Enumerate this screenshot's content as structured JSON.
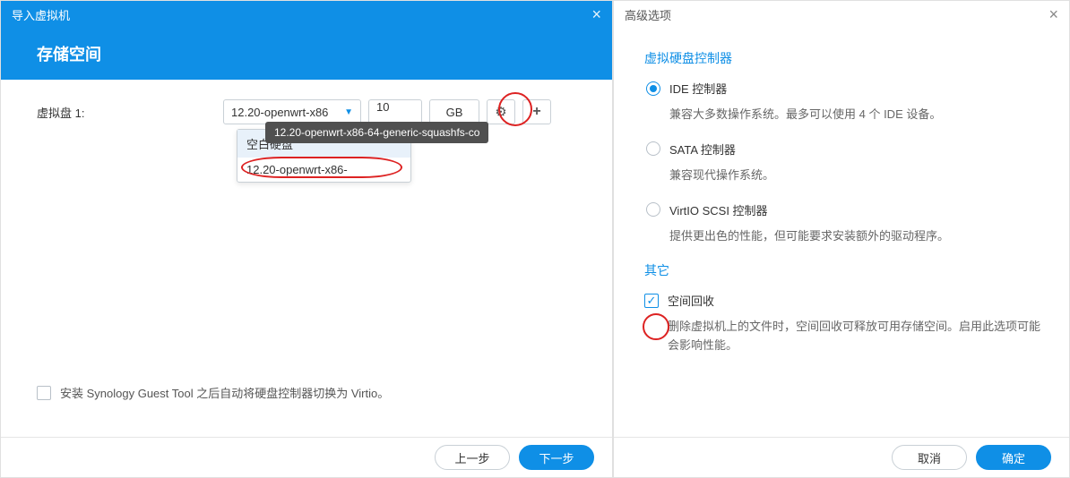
{
  "left": {
    "title": "导入虚拟机",
    "subtitle": "存储空间",
    "disk_label": "虚拟盘 1:",
    "disk_select_value": "12.20-openwrt-x86",
    "disk_size_value": "10",
    "disk_size_unit": "GB",
    "tooltip": "12.20-openwrt-x86-64-generic-squashfs-co",
    "dropdown": {
      "items": [
        "空白硬盘",
        "12.20-openwrt-x86-"
      ]
    },
    "guest_tool_label": "安装 Synology Guest Tool 之后自动将硬盘控制器切换为 Virtio。",
    "btn_prev": "上一步",
    "btn_next": "下一步"
  },
  "right": {
    "title": "高级选项",
    "section_controller": "虚拟硬盘控制器",
    "controllers": [
      {
        "label": "IDE 控制器",
        "desc": "兼容大多数操作系统。最多可以使用 4 个 IDE 设备。",
        "selected": true
      },
      {
        "label": "SATA 控制器",
        "desc": "兼容现代操作系统。",
        "selected": false
      },
      {
        "label": "VirtIO SCSI 控制器",
        "desc": "提供更出色的性能，但可能要求安装额外的驱动程序。",
        "selected": false
      }
    ],
    "section_other": "其它",
    "space_reclaim_label": "空间回收",
    "space_reclaim_desc": "删除虚拟机上的文件时，空间回收可释放可用存储空间。启用此选项可能会影响性能。",
    "btn_cancel": "取消",
    "btn_ok": "确定"
  }
}
